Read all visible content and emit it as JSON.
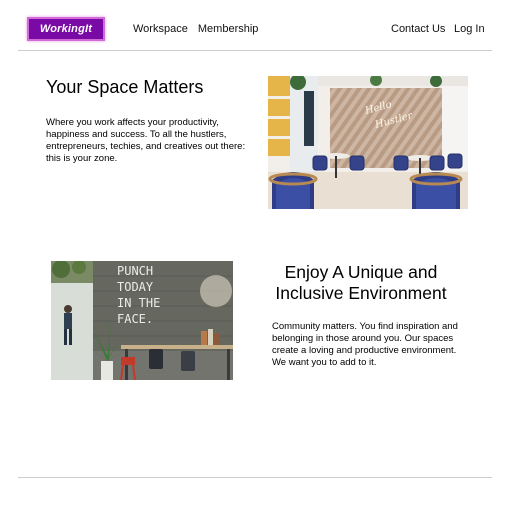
{
  "header": {
    "logo_text": "WorkingIt",
    "nav": {
      "workspace": "Workspace",
      "membership": "Membership",
      "contact": "Contact Us",
      "login": "Log In"
    }
  },
  "section1": {
    "title": "Your Space Matters",
    "body": "Where you work affects your productivity, happiness and success. To all the hustlers, entrepreneurs, techies, and creatives out there: this is your zone.",
    "image_sign": "Hello Hustler"
  },
  "section2": {
    "title": "Enjoy A Unique and Inclusive Environment",
    "body": "Community matters. You find inspiration and belonging in those around you. Our spaces create a loving and productive environment. We want you to add to it.",
    "image_wall_text": [
      "PUNCH",
      "TODAY",
      "IN THE",
      "FACE."
    ]
  },
  "colors": {
    "logo_bg": "#7a0aa6",
    "logo_border": "#d26bd8",
    "divider": "#cccccc"
  }
}
